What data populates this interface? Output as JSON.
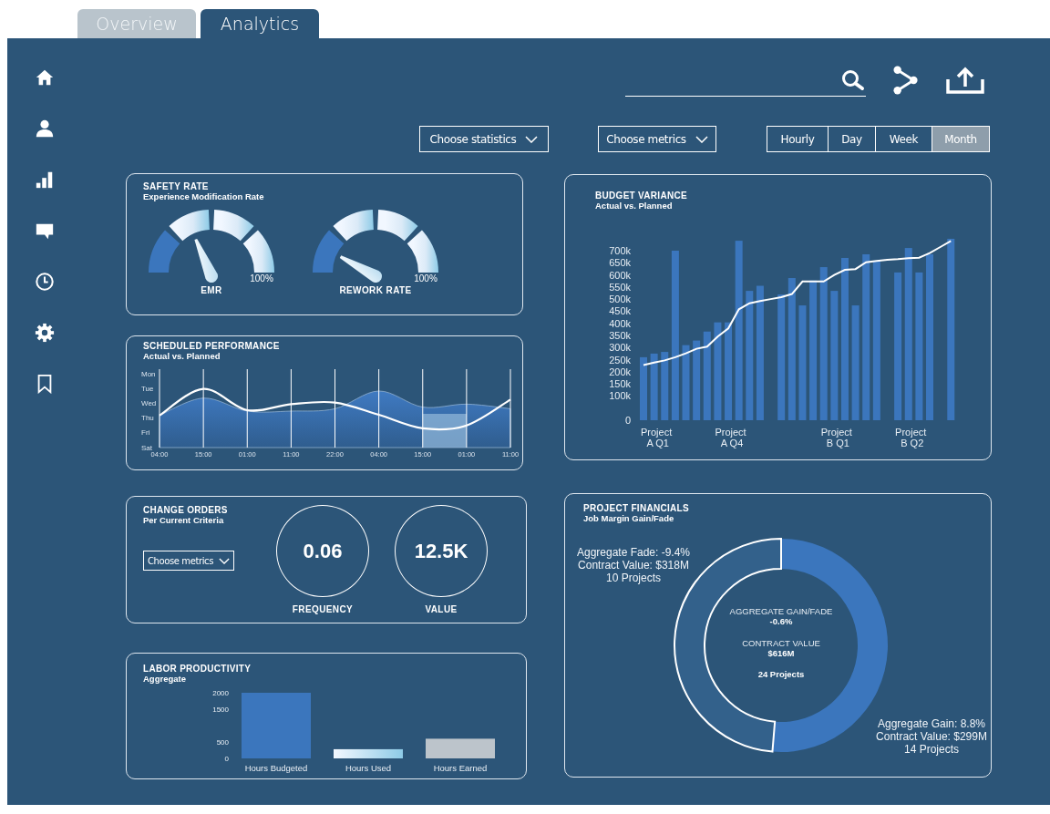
{
  "tabs": [
    {
      "label": "Overview",
      "selected": false
    },
    {
      "label": "Analytics",
      "selected": true
    }
  ],
  "filters": {
    "dropdowns": [
      "Choose statistics",
      "Choose metrics"
    ],
    "periods": [
      {
        "label": "Hourly",
        "selected": false
      },
      {
        "label": "Day",
        "selected": false
      },
      {
        "label": "Week",
        "selected": false
      },
      {
        "label": "Month",
        "selected": true
      }
    ]
  },
  "safety_rate": {
    "title": "SAFETY RATE",
    "subtitle": "Experience Modification Rate",
    "gauges": [
      {
        "label": "EMR",
        "max_label": "100%"
      },
      {
        "label": "REWORK RATE",
        "max_label": "100%"
      }
    ]
  },
  "scheduled_performance": {
    "title": "SCHEDULED PERFORMANCE",
    "subtitle": "Actual vs. Planned",
    "y_labels": [
      "Mon",
      "Tue",
      "Wed",
      "Thu",
      "Fri",
      "Sat"
    ],
    "x_labels": [
      "04:00",
      "15:00",
      "01:00",
      "11:00",
      "22:00",
      "04:00",
      "15:00",
      "01:00",
      "11:00"
    ]
  },
  "change_orders": {
    "title": "CHANGE ORDERS",
    "subtitle": "Per Current Criteria",
    "dropdown": "Choose metrics",
    "stats": [
      {
        "value": "0.06",
        "label": "FREQUENCY"
      },
      {
        "value": "12.5K",
        "label": "VALUE"
      }
    ]
  },
  "labor_productivity": {
    "title": "LABOR PRODUCTIVITY",
    "subtitle": "Aggregate",
    "chart_data": {
      "type": "bar",
      "categories": [
        "Hours Budgeted",
        "Hours Used",
        "Hours Earned"
      ],
      "ylim": [
        0,
        2000
      ],
      "yticks": [
        0,
        500,
        1500,
        2000
      ],
      "series": [
        {
          "values": [
            2000,
            280,
            600
          ]
        }
      ]
    }
  },
  "budget_variance": {
    "title": "BUDGET VARIANCE",
    "subtitle": "Actual vs. Planned",
    "chart_data": {
      "type": "bar",
      "categories": [
        null,
        "Project A Q1",
        null,
        null,
        null,
        null,
        null,
        null,
        "Project A Q4",
        null,
        null,
        null,
        null,
        null,
        null,
        null,
        null,
        null,
        "Project B Q1",
        null,
        null,
        null,
        null,
        null,
        null,
        "Project B Q2",
        null,
        null,
        null,
        null
      ],
      "ylim": [
        0,
        750000
      ],
      "yticks": [
        {
          "value": 0,
          "label": "0"
        },
        {
          "value": 100000,
          "label": "100k"
        },
        {
          "value": 150000,
          "label": "150k"
        },
        {
          "value": 200000,
          "label": "200k"
        },
        {
          "value": 250000,
          "label": "250k"
        },
        {
          "value": 300000,
          "label": "300k"
        },
        {
          "value": 350000,
          "label": "350k"
        },
        {
          "value": 400000,
          "label": "400k"
        },
        {
          "value": 450000,
          "label": "450k"
        },
        {
          "value": 500000,
          "label": "500k"
        },
        {
          "value": 550000,
          "label": "550k"
        },
        {
          "value": 600000,
          "label": "600k"
        },
        {
          "value": 650000,
          "label": "650k"
        },
        {
          "value": 700000,
          "label": "700k"
        }
      ],
      "series": [
        {
          "color": "#3b76bd",
          "values": [
            260000,
            275000,
            282000,
            700000,
            310000,
            329000,
            366000,
            404000,
            404000,
            741000,
            534000,
            555000,
            null,
            519000,
            587000,
            474000,
            577000,
            632000,
            534000,
            670000,
            474000,
            685000,
            659000,
            null,
            610000,
            711000,
            610000,
            685000,
            null,
            749000
          ]
        },
        {
          "type": "line",
          "color": "#ffffff",
          "values": [
            228000,
            238000,
            247000,
            260000,
            276000,
            295000,
            304000,
            345000,
            379000,
            458000,
            483000,
            492000,
            500000,
            508000,
            521000,
            573000,
            573000,
            573000,
            600000,
            621000,
            624000,
            652000,
            658000,
            662000,
            665000,
            669000,
            671000,
            690000,
            715000,
            740000
          ]
        }
      ]
    }
  },
  "project_financials": {
    "title": "PROJECT FINANCIALS",
    "subtitle": "Job Margin Gain/Fade",
    "chart_data": {
      "type": "donut",
      "values": [
        51.3,
        48.7
      ]
    },
    "callouts": [
      {
        "lines": [
          "Aggregate Fade: -9.4%",
          "Contract Value: $318M",
          "10 Projects"
        ]
      },
      {
        "lines": [
          "Aggregate Gain: 8.8%",
          "Contract Value: $299M",
          "14 Projects"
        ]
      }
    ],
    "center": [
      {
        "text": "AGGREGATE GAIN/FADE",
        "kind": "label"
      },
      {
        "text": "-0.6%",
        "kind": "value"
      },
      {
        "text": "CONTRACT VALUE",
        "kind": "label"
      },
      {
        "text": "$616M",
        "kind": "value"
      },
      {
        "text": "24 Projects",
        "kind": "value"
      }
    ]
  }
}
